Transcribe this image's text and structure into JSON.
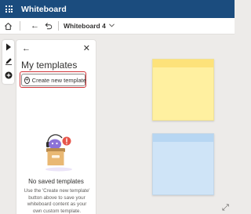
{
  "app": {
    "name": "Whiteboard"
  },
  "toolbar": {
    "board_title": "Whiteboard 4"
  },
  "panel": {
    "heading": "My templates",
    "create_button_label": "Create new template",
    "empty_title": "No saved templates",
    "empty_description": "Use the 'Create new template' button above to save your whiteboard content as your own custom template."
  },
  "icons": {
    "app_launcher": "waffle-icon",
    "home": "home-icon",
    "back": "back-arrow-icon",
    "undo": "undo-icon",
    "board_menu": "chevron-down-icon",
    "select_tool": "pointer-icon",
    "pen_tool": "pen-icon",
    "add_tool": "add-icon",
    "panel_back": "back-arrow-icon",
    "panel_close": "close-icon",
    "create": "plus-circle-icon",
    "fit": "fit-to-screen-icon"
  },
  "colors": {
    "titlebar": "#1b4c7e",
    "canvas": "#edebe9",
    "highlight": "#d13438",
    "sticky_yellow": "#fff0a0",
    "sticky_yellow_band": "#fde27a",
    "sticky_blue": "#cfe4f7",
    "sticky_blue_band": "#b7d6f2"
  }
}
